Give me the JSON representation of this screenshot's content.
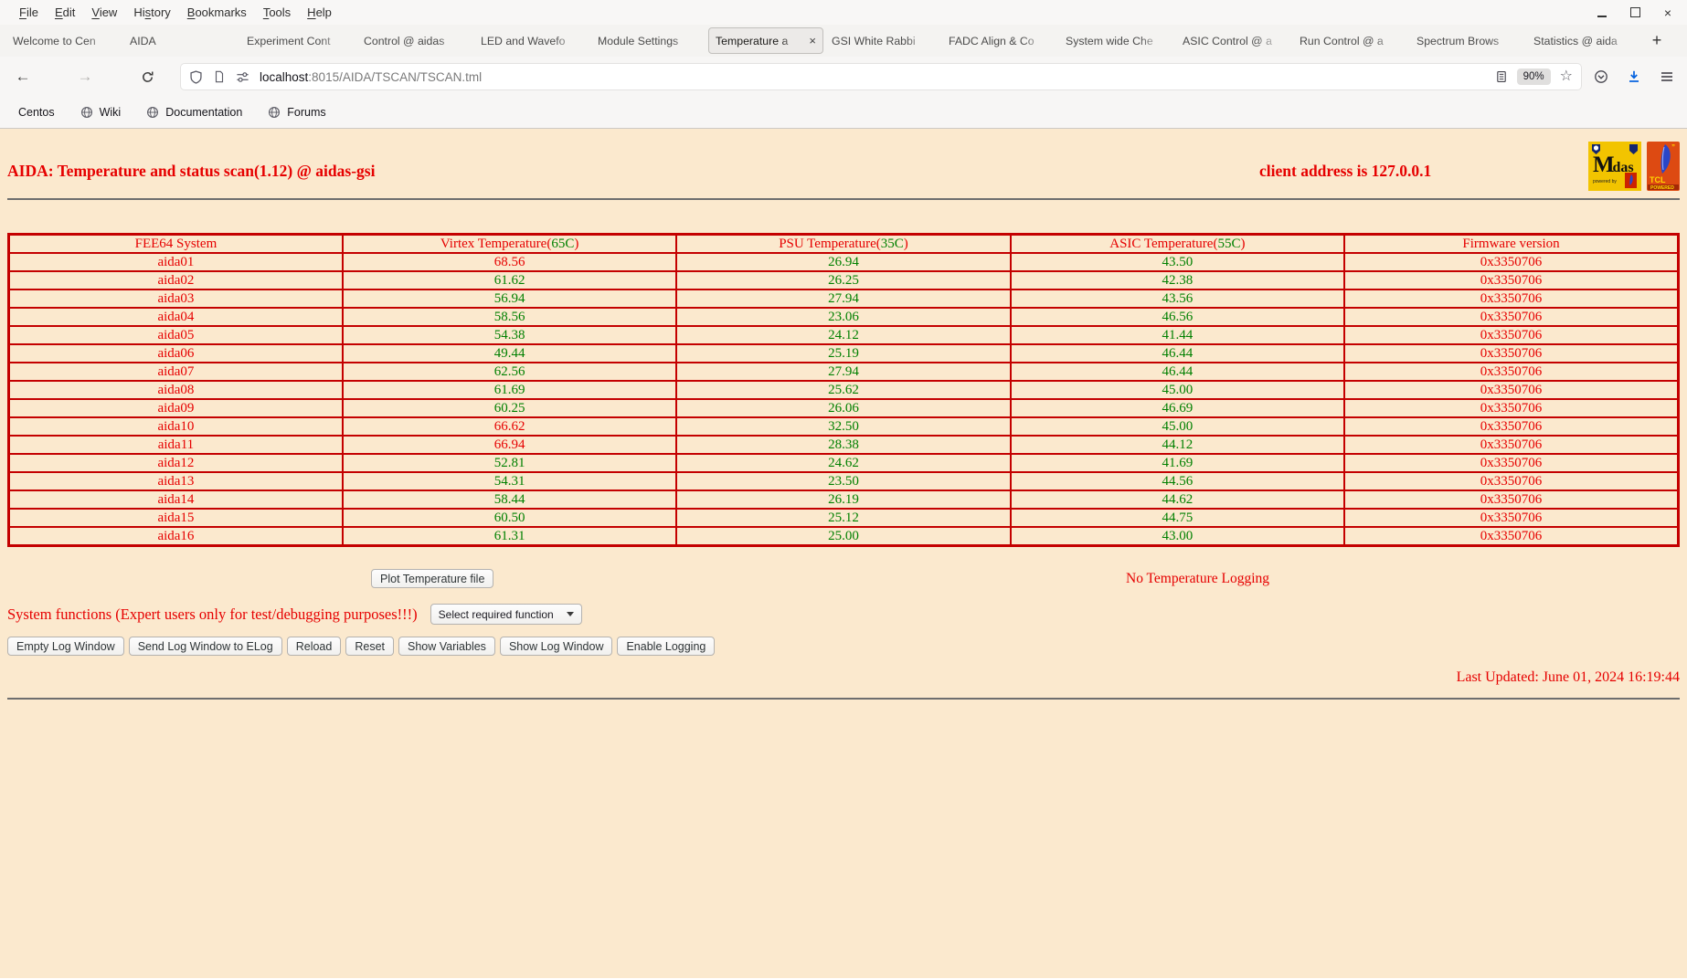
{
  "menubar": {
    "items": [
      {
        "label": "File",
        "accel": 0
      },
      {
        "label": "Edit",
        "accel": 0
      },
      {
        "label": "View",
        "accel": 0
      },
      {
        "label": "History",
        "accel": 2
      },
      {
        "label": "Bookmarks",
        "accel": 0
      },
      {
        "label": "Tools",
        "accel": 0
      },
      {
        "label": "Help",
        "accel": 0
      }
    ]
  },
  "tabbar": {
    "new_tab_label": "+",
    "tabs": [
      {
        "label": "Welcome to Cen",
        "active": false,
        "closable": false
      },
      {
        "label": "AIDA",
        "active": false,
        "closable": false
      },
      {
        "label": "Experiment Cont",
        "active": false,
        "closable": false
      },
      {
        "label": "Control @ aidas",
        "active": false,
        "closable": false
      },
      {
        "label": "LED and Wavefo",
        "active": false,
        "closable": false
      },
      {
        "label": "Module Settings",
        "active": false,
        "closable": false
      },
      {
        "label": "Temperature a",
        "active": true,
        "closable": true
      },
      {
        "label": "GSI White Rabbi",
        "active": false,
        "closable": false
      },
      {
        "label": "FADC Align & Co",
        "active": false,
        "closable": false
      },
      {
        "label": "System wide Che",
        "active": false,
        "closable": false
      },
      {
        "label": "ASIC Control @ a",
        "active": false,
        "closable": false
      },
      {
        "label": "Run Control @ a",
        "active": false,
        "closable": false
      },
      {
        "label": "Spectrum Brows",
        "active": false,
        "closable": false
      },
      {
        "label": "Statistics @ aida",
        "active": false,
        "closable": false
      }
    ]
  },
  "navbar": {
    "url_host": "localhost",
    "url_rest": ":8015/AIDA/TSCAN/TSCAN.tml",
    "zoom_level": "90%"
  },
  "bookmarks": {
    "items": [
      {
        "label": "Centos",
        "icon": "centos"
      },
      {
        "label": "Wiki",
        "icon": "globe"
      },
      {
        "label": "Documentation",
        "icon": "globe"
      },
      {
        "label": "Forums",
        "icon": "globe"
      }
    ]
  },
  "page": {
    "title": "AIDA: Temperature and status scan(1.12) @ aidas-gsi",
    "client_address": "client address is 127.0.0.1",
    "logos": {
      "midas": {
        "text": "Midas",
        "powered_by": "powered by"
      },
      "tcl": {
        "text": "TCL",
        "powered": "POWERED"
      }
    },
    "table": {
      "columns": [
        {
          "label": "FEE64 System"
        },
        {
          "label": "Virtex Temperature",
          "threshold": 65,
          "threshold_text": "65C"
        },
        {
          "label": "PSU Temperature",
          "threshold": 35,
          "threshold_text": "35C"
        },
        {
          "label": "ASIC Temperature",
          "threshold": 55,
          "threshold_text": "55C"
        },
        {
          "label": "Firmware version"
        }
      ],
      "rows": [
        {
          "system": "aida01",
          "virtex": "68.56",
          "psu": "26.94",
          "asic": "43.50",
          "firmware": "0x3350706"
        },
        {
          "system": "aida02",
          "virtex": "61.62",
          "psu": "26.25",
          "asic": "42.38",
          "firmware": "0x3350706"
        },
        {
          "system": "aida03",
          "virtex": "56.94",
          "psu": "27.94",
          "asic": "43.56",
          "firmware": "0x3350706"
        },
        {
          "system": "aida04",
          "virtex": "58.56",
          "psu": "23.06",
          "asic": "46.56",
          "firmware": "0x3350706"
        },
        {
          "system": "aida05",
          "virtex": "54.38",
          "psu": "24.12",
          "asic": "41.44",
          "firmware": "0x3350706"
        },
        {
          "system": "aida06",
          "virtex": "49.44",
          "psu": "25.19",
          "asic": "46.44",
          "firmware": "0x3350706"
        },
        {
          "system": "aida07",
          "virtex": "62.56",
          "psu": "27.94",
          "asic": "46.44",
          "firmware": "0x3350706"
        },
        {
          "system": "aida08",
          "virtex": "61.69",
          "psu": "25.62",
          "asic": "45.00",
          "firmware": "0x3350706"
        },
        {
          "system": "aida09",
          "virtex": "60.25",
          "psu": "26.06",
          "asic": "46.69",
          "firmware": "0x3350706"
        },
        {
          "system": "aida10",
          "virtex": "66.62",
          "psu": "32.50",
          "asic": "45.00",
          "firmware": "0x3350706"
        },
        {
          "system": "aida11",
          "virtex": "66.94",
          "psu": "28.38",
          "asic": "44.12",
          "firmware": "0x3350706"
        },
        {
          "system": "aida12",
          "virtex": "52.81",
          "psu": "24.62",
          "asic": "41.69",
          "firmware": "0x3350706"
        },
        {
          "system": "aida13",
          "virtex": "54.31",
          "psu": "23.50",
          "asic": "44.56",
          "firmware": "0x3350706"
        },
        {
          "system": "aida14",
          "virtex": "58.44",
          "psu": "26.19",
          "asic": "44.62",
          "firmware": "0x3350706"
        },
        {
          "system": "aida15",
          "virtex": "60.50",
          "psu": "25.12",
          "asic": "44.75",
          "firmware": "0x3350706"
        },
        {
          "system": "aida16",
          "virtex": "61.31",
          "psu": "25.00",
          "asic": "43.00",
          "firmware": "0x3350706"
        }
      ]
    },
    "plot_button_label": "Plot Temperature file",
    "logging_status": "No Temperature Logging",
    "system_functions_label": "System functions (Expert users only for test/debugging purposes!!!)",
    "select_placeholder": "Select required function",
    "action_buttons": [
      "Empty Log Window",
      "Send Log Window to ELog",
      "Reload",
      "Reset",
      "Show Variables",
      "Show Log Window",
      "Enable Logging"
    ],
    "last_updated": "Last Updated: June 01, 2024 16:19:44"
  },
  "colors": {
    "page_background": "#fbe9ce",
    "alert_red": "#e60000",
    "ok_green": "#008000",
    "table_border_red": "#c40000",
    "download_blue": "#0060df"
  }
}
